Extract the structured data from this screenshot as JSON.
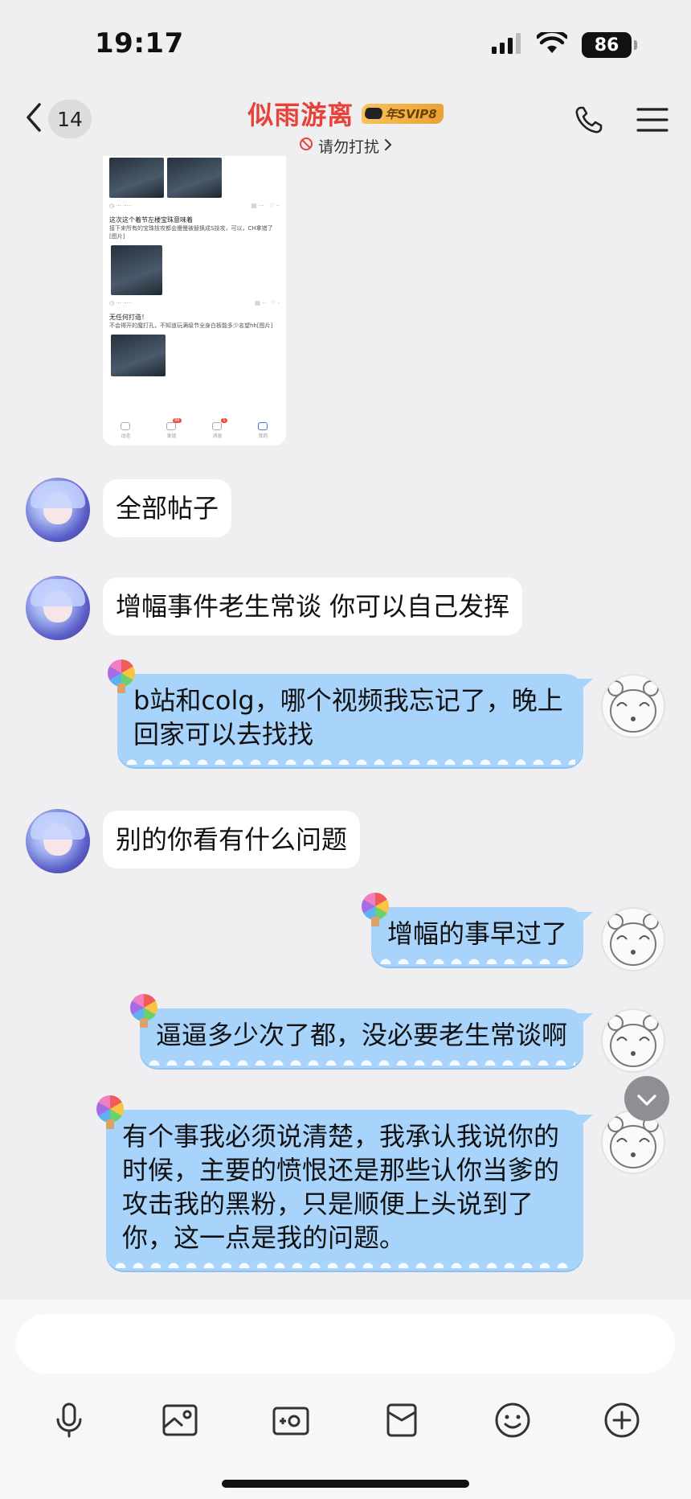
{
  "status_bar": {
    "time": "19:17",
    "battery": "86",
    "icons": [
      "signal-icon",
      "wifi-icon",
      "battery-icon"
    ]
  },
  "header": {
    "unread_count": "14",
    "contact_name": "似雨游离",
    "svip_badge": "年SVIP8",
    "status": "请勿打扰",
    "icons": [
      "back-chevron-icon",
      "phone-icon",
      "menu-icon"
    ]
  },
  "shared_image": {
    "post1_title": "这次这个着节左楼宝珠意味着",
    "post1_body": "接下来所有的宝珠技攻都会慢慢被替换成S技攻，可以，CH拿错了[图片]",
    "post2_title": "无任何打造！",
    "post2_body": "不会得开的魔打孔，不知道玩满级节全身白板能多少名望hh[图片]",
    "tabs": [
      {
        "label": "动态",
        "badge": ""
      },
      {
        "label": "发现",
        "badge": "99"
      },
      {
        "label": "消息",
        "badge": "1"
      },
      {
        "label": "我的",
        "badge": ""
      }
    ]
  },
  "messages": [
    {
      "side": "left",
      "text": "全部帖子"
    },
    {
      "side": "left",
      "text": "增幅事件老生常谈 你可以自己发挥"
    },
    {
      "side": "right",
      "text": "b站和colg，哪个视频我忘记了，晚上回家可以去找找"
    },
    {
      "side": "left",
      "text": "别的你看有什么问题"
    },
    {
      "side": "right",
      "text": "增幅的事早过了"
    },
    {
      "side": "right",
      "text": "逼逼多少次了都，没必要老生常谈啊"
    },
    {
      "side": "right",
      "text": "有个事我必须说清楚，我承认我说你的时候，主要的愤恨还是那些认你当爹的攻击我的黑粉，只是顺便上头说到了你，这一点是我的问题。"
    }
  ],
  "input": {
    "placeholder": "",
    "toolbar": [
      "microphone-icon",
      "image-icon",
      "camera-icon",
      "red-packet-icon",
      "emoji-icon",
      "plus-icon"
    ]
  },
  "colors": {
    "accent_name": "#e8413a",
    "bubble_self": "#a8d4fb",
    "bubble_other": "#ffffff",
    "background": "#efeff1"
  }
}
